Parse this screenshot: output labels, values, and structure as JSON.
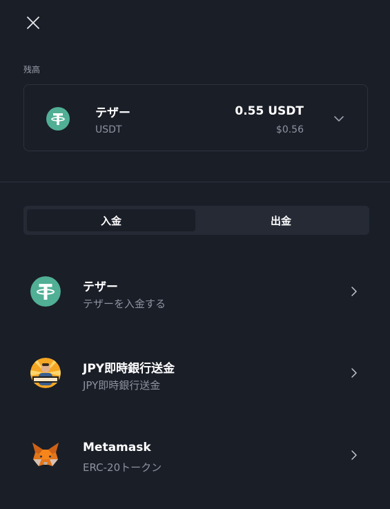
{
  "balance": {
    "section_label": "残高",
    "name": "テザー",
    "symbol": "USDT",
    "amount": "0.55 USDT",
    "fiat": "$0.56"
  },
  "tabs": [
    {
      "label": "入金",
      "active": true
    },
    {
      "label": "出金",
      "active": false
    }
  ],
  "methods": [
    {
      "title": "テザー",
      "subtitle": "テザーを入金する",
      "icon": "tether-icon"
    },
    {
      "title": "JPY即時銀行送金",
      "subtitle": "JPY即時銀行送金",
      "icon": "bank-avatar-icon"
    },
    {
      "title": "Metamask",
      "subtitle": "ERC-20トークン",
      "icon": "metamask-fox-icon"
    }
  ],
  "colors": {
    "background": "#1a1e27",
    "tether_green": "#50af95",
    "tab_bg": "#252a35",
    "muted_text": "#8d93a0"
  }
}
